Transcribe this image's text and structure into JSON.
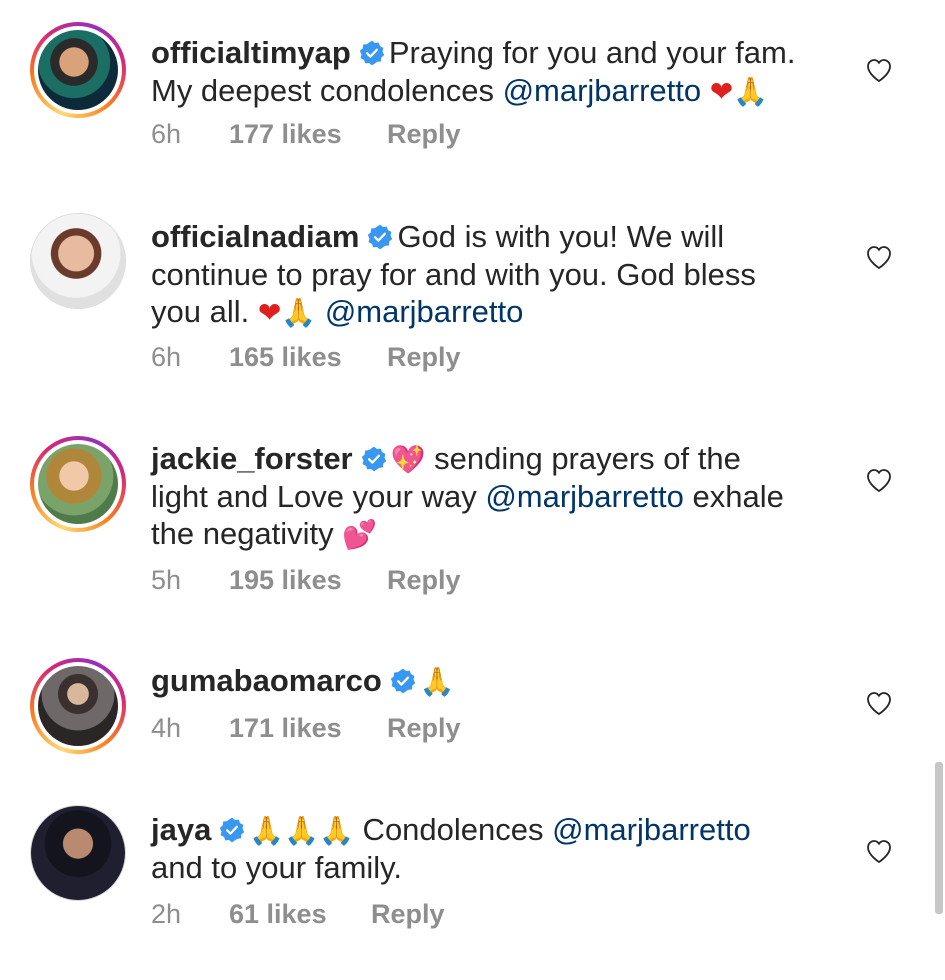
{
  "comments": [
    {
      "username": "officialtimyap",
      "lines": [
        [
          {
            "t": "Praying for you and your fam."
          }
        ],
        [
          {
            "t": "My deepest condolences "
          },
          {
            "t": "@marjbarretto",
            "c": "mention"
          },
          {
            "t": " "
          },
          {
            "t": "❤",
            "c": "emoji heart-red"
          },
          {
            "t": "🙏",
            "c": "emoji pray"
          }
        ]
      ],
      "time": "6h",
      "likes": "177 likes",
      "reply": "Reply"
    },
    {
      "username": "officialnadiam",
      "lines": [
        [
          {
            "t": "God is with you! We will"
          }
        ],
        [
          {
            "t": "continue to pray for and with you. God bless"
          }
        ],
        [
          {
            "t": "you all. "
          },
          {
            "t": "❤",
            "c": "emoji heart-red"
          },
          {
            "t": "🙏",
            "c": "emoji pray"
          },
          {
            "t": " "
          },
          {
            "t": "@marjbarretto",
            "c": "mention"
          }
        ]
      ],
      "time": "6h",
      "likes": "165 likes",
      "reply": "Reply"
    },
    {
      "username": "jackie_forster",
      "lines": [
        [
          {
            "t": "💖",
            "c": "emoji pray"
          },
          {
            "t": " sending prayers of the"
          }
        ],
        [
          {
            "t": "light and Love your way "
          },
          {
            "t": "@marjbarretto",
            "c": "mention"
          },
          {
            "t": " exhale"
          }
        ],
        [
          {
            "t": "the  negativity "
          },
          {
            "t": "💕",
            "c": "emoji pink"
          }
        ]
      ],
      "time": "5h",
      "likes": "195 likes",
      "reply": "Reply"
    },
    {
      "username": "gumabaomarco",
      "lines": [
        [
          {
            "t": "🙏",
            "c": "emoji pray"
          }
        ]
      ],
      "time": "4h",
      "likes": "171 likes",
      "reply": "Reply"
    },
    {
      "username": "jaya",
      "lines": [
        [
          {
            "t": "🙏🙏🙏",
            "c": "emoji pray"
          },
          {
            "t": " Condolences "
          },
          {
            "t": "@marjbarretto",
            "c": "mention"
          }
        ],
        [
          {
            "t": "and to your family."
          }
        ]
      ],
      "time": "2h",
      "likes": "61 likes",
      "reply": "Reply"
    }
  ],
  "icons": {
    "verified": "verified-badge-icon",
    "like": "heart-outline-icon"
  },
  "colors": {
    "verified": "#3897f0",
    "mention": "#003569",
    "meta": "#8e8e8e",
    "text": "#262626"
  }
}
